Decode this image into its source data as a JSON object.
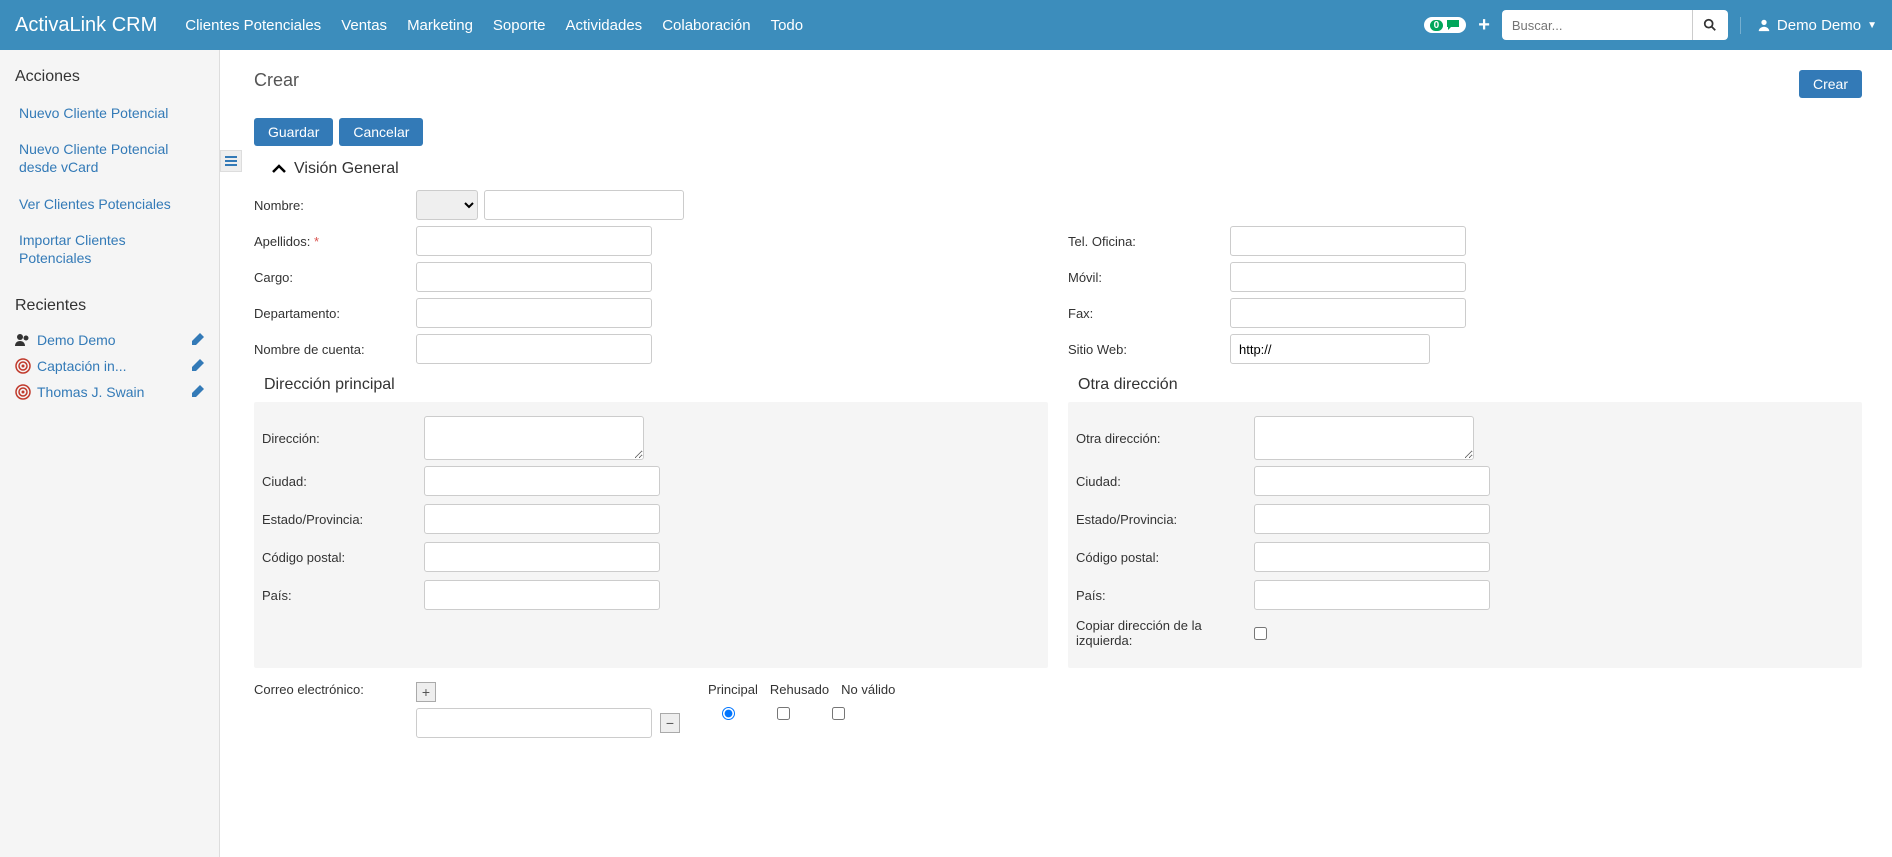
{
  "brand": "ActivaLink CRM",
  "nav": [
    "Clientes Potenciales",
    "Ventas",
    "Marketing",
    "Soporte",
    "Actividades",
    "Colaboración",
    "Todo"
  ],
  "chat_count": "0",
  "search_placeholder": "Buscar...",
  "user_name": "Demo Demo",
  "sidebar": {
    "actions_title": "Acciones",
    "actions": [
      "Nuevo Cliente Potencial",
      "Nuevo Cliente Potencial desde vCard",
      "Ver Clientes Potenciales",
      "Importar Clientes Potenciales"
    ],
    "recent_title": "Recientes",
    "recent": [
      {
        "label": "Demo Demo"
      },
      {
        "label": "Captación in..."
      },
      {
        "label": "Thomas J. Swain"
      }
    ]
  },
  "page": {
    "title": "Crear",
    "create_btn": "Crear",
    "save_btn": "Guardar",
    "cancel_btn": "Cancelar",
    "section_overview": "Visión General"
  },
  "labels": {
    "nombre": "Nombre:",
    "apellidos": "Apellidos:",
    "cargo": "Cargo:",
    "departamento": "Departamento:",
    "nombre_cuenta": "Nombre de cuenta:",
    "tel_oficina": "Tel. Oficina:",
    "movil": "Móvil:",
    "fax": "Fax:",
    "sitio_web": "Sitio Web:",
    "direccion_principal": "Dirección principal",
    "otra_direccion_head": "Otra dirección",
    "direccion": "Dirección:",
    "otra_direccion": "Otra dirección:",
    "ciudad": "Ciudad:",
    "estado": "Estado/Provincia:",
    "codigo_postal": "Código postal:",
    "pais": "País:",
    "copiar": "Copiar dirección de la izquierda:",
    "correo": "Correo electrónico:"
  },
  "values": {
    "sitio_web": "http://"
  },
  "email_headers": {
    "principal": "Principal",
    "rehusado": "Rehusado",
    "no_valido": "No válido"
  }
}
